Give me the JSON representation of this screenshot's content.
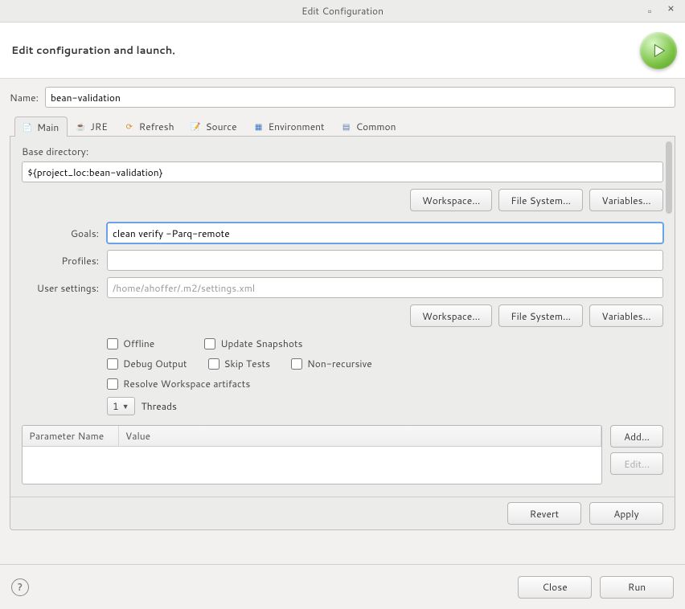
{
  "window": {
    "title": "Edit Configuration"
  },
  "banner": {
    "heading": "Edit configuration and launch."
  },
  "name": {
    "label": "Name:",
    "value": "bean-validation"
  },
  "tabs": [
    "Main",
    "JRE",
    "Refresh",
    "Source",
    "Environment",
    "Common"
  ],
  "active_tab_index": 0,
  "main_tab": {
    "base_dir_label": "Base directory:",
    "base_dir_value": "${project_loc:bean-validation}",
    "workspace_btn": "Workspace...",
    "filesystem_btn": "File System...",
    "variables_btn": "Variables...",
    "goals_label": "Goals:",
    "goals_value": "clean verify -Parq-remote",
    "profiles_label": "Profiles:",
    "profiles_value": "",
    "user_settings_label": "User settings:",
    "user_settings_value": "/home/ahoffer/.m2/settings.xml",
    "chk_offline": "Offline",
    "chk_update_snapshots": "Update Snapshots",
    "chk_debug_output": "Debug Output",
    "chk_skip_tests": "Skip Tests",
    "chk_non_recursive": "Non-recursive",
    "chk_resolve_ws": "Resolve Workspace artifacts",
    "threads_value": "1",
    "threads_label": "Threads",
    "param_col_name": "Parameter Name",
    "param_col_value": "Value",
    "add_btn": "Add...",
    "edit_btn": "Edit...",
    "revert_btn": "Revert",
    "apply_btn": "Apply"
  },
  "footer": {
    "help": "?",
    "close": "Close",
    "run": "Run"
  }
}
